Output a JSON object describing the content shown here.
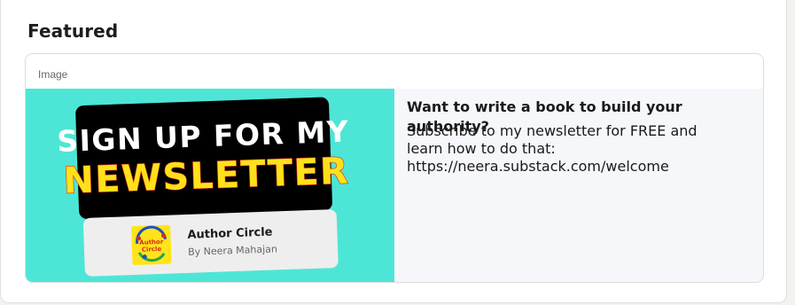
{
  "section": {
    "title": "Featured"
  },
  "featured_item": {
    "type_label": "Image",
    "title": "Want to write a book to build your authority?",
    "description": "Subscribe to my newsletter for FREE and learn how to do that: https://neera.substack.com/welcome",
    "image": {
      "banner_line1": "SIGN UP FOR MY",
      "banner_line2": "NEWSLETTER",
      "logo_text_line1": "Author",
      "logo_text_line2": "Circle",
      "publication_name": "Author Circle",
      "byline": "By Neera Mahajan"
    }
  },
  "colors": {
    "image_background": "#4de6d6",
    "banner_background": "#000000",
    "banner_line1": "#ffffff",
    "banner_line2": "#ffe11a",
    "content_background": "#f5f7fb"
  }
}
